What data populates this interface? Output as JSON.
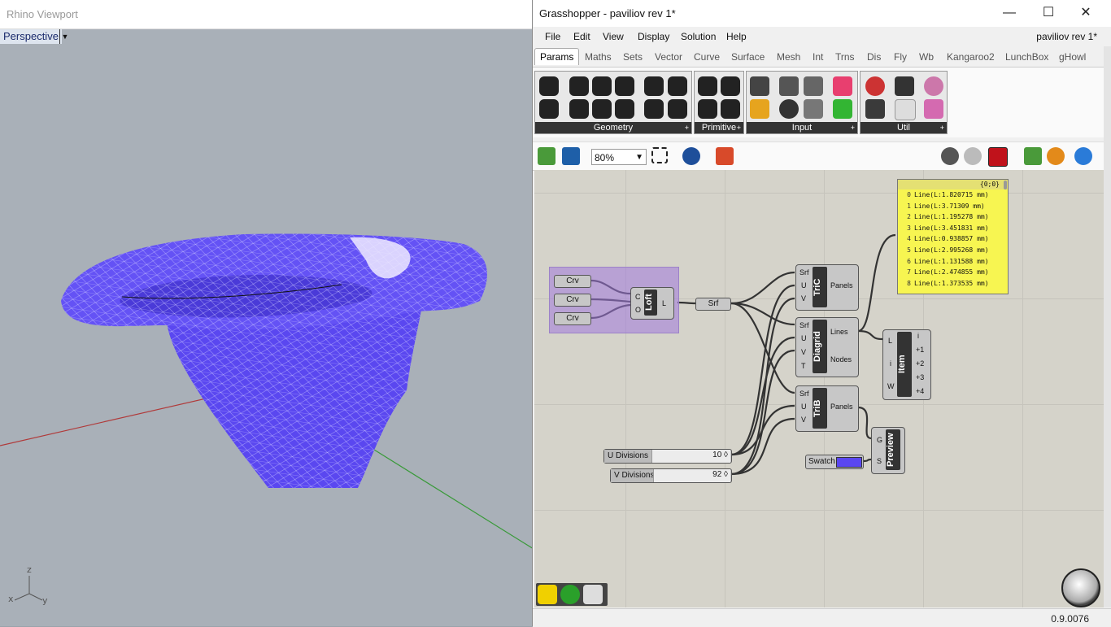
{
  "rhino": {
    "title": "Rhino Viewport",
    "viewport_label": "Perspective",
    "axis_labels": {
      "z": "z",
      "x": "x",
      "y": "y"
    },
    "surface_color": "#5a47f0"
  },
  "gh": {
    "title": "Grasshopper - paviliov rev 1*",
    "window_controls": {
      "minimize": "—",
      "maximize": "☐",
      "close": "✕"
    },
    "menu": [
      "File",
      "Edit",
      "View",
      "Display",
      "Solution",
      "Help"
    ],
    "document_name": "paviliov rev 1*",
    "tabs": [
      "Params",
      "Maths",
      "Sets",
      "Vector",
      "Curve",
      "Surface",
      "Mesh",
      "Int",
      "Trns",
      "Dis",
      "Fly",
      "Wb",
      "Kangaroo2",
      "LunchBox",
      "gHowl"
    ],
    "active_tab": "Params",
    "ribbon_panels": [
      "Geometry",
      "Primitive",
      "Input",
      "Util"
    ],
    "ribbon_panel_more": "+",
    "zoom": "80%",
    "version": "0.9.0076"
  },
  "components": {
    "crv_params": [
      "Crv",
      "Crv",
      "Crv"
    ],
    "loft": {
      "name": "Loft",
      "inputs": [
        "C",
        "O"
      ],
      "outputs": [
        "L"
      ]
    },
    "srf_param": "Srf",
    "tric": {
      "name": "TriC",
      "inputs": [
        "Srf",
        "U",
        "V"
      ],
      "outputs": [
        "Panels"
      ]
    },
    "diagrid": {
      "name": "Diagrid",
      "inputs": [
        "Srf",
        "U",
        "V",
        "T"
      ],
      "outputs": [
        "Lines",
        "Nodes"
      ]
    },
    "trib": {
      "name": "TriB",
      "inputs": [
        "Srf",
        "U",
        "V"
      ],
      "outputs": [
        "Panels"
      ]
    },
    "item": {
      "name": "Item",
      "inputs": [
        "L",
        "i",
        "W"
      ],
      "outputs": [
        "i",
        "+1",
        "+2",
        "+3",
        "+4"
      ]
    },
    "preview": {
      "name": "Preview",
      "inputs": [
        "G",
        "S"
      ]
    },
    "swatch": {
      "name": "Swatch",
      "color": "#5a47f0"
    },
    "u_slider": {
      "name": "U Divisions",
      "value": "10",
      "glyph": "◊"
    },
    "v_slider": {
      "name": "V Divisions",
      "value": "92",
      "glyph": "◊"
    },
    "panel": {
      "header": "{0;0}",
      "rows": [
        {
          "i": "0",
          "text": "Line(L:1.820715 mm)"
        },
        {
          "i": "1",
          "text": "Line(L:3.71309 mm)"
        },
        {
          "i": "2",
          "text": "Line(L:1.195278 mm)"
        },
        {
          "i": "3",
          "text": "Line(L:3.451831 mm)"
        },
        {
          "i": "4",
          "text": "Line(L:0.938857 mm)"
        },
        {
          "i": "5",
          "text": "Line(L:2.995268 mm)"
        },
        {
          "i": "6",
          "text": "Line(L:1.131588 mm)"
        },
        {
          "i": "7",
          "text": "Line(L:2.474855 mm)"
        },
        {
          "i": "8",
          "text": "Line(L:1.373535 mm)"
        }
      ]
    }
  },
  "bottom_icons": [
    "undo-icon",
    "sphere-icon",
    "cube-icon"
  ]
}
